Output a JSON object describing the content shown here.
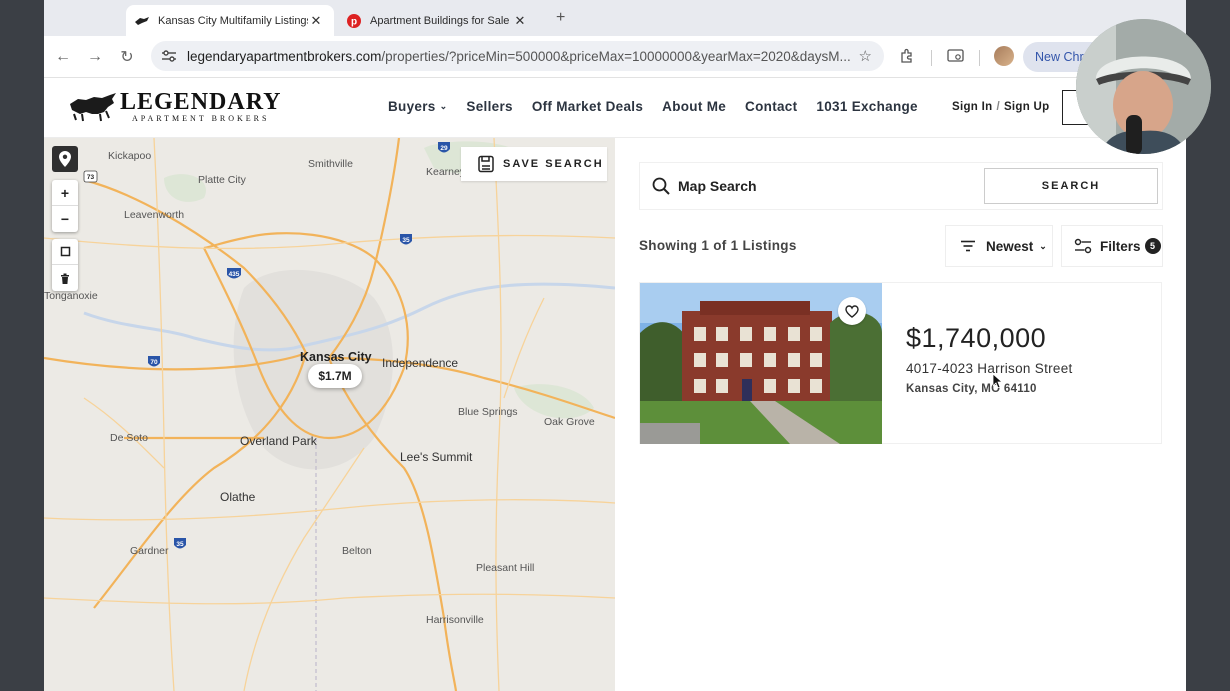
{
  "browser": {
    "tabs": [
      {
        "title": "Kansas City Multifamily Listings",
        "active": true
      },
      {
        "title": "Apartment Buildings for Sale",
        "active": false
      }
    ],
    "url_host": "legendaryapartmentbrokers.com",
    "url_path": "/properties/?priceMin=500000&priceMax=10000000&yearMax=2020&daysM...",
    "new_chrome_label": "New Chro"
  },
  "site": {
    "logo_main": "LEGENDARY",
    "logo_sub": "APARTMENT BROKERS",
    "nav": [
      "Buyers",
      "Sellers",
      "Off Market Deals",
      "About Me",
      "Contact",
      "1031 Exchange"
    ],
    "sign_in": "Sign In",
    "sign_up": "Sign Up",
    "sign_sep": "/"
  },
  "map": {
    "save_search": "SAVE SEARCH",
    "marker_price": "$1.7M",
    "labels": {
      "kansas_city": "Kansas City",
      "kickapoo": "Kickapoo",
      "platte_city": "Platte City",
      "smithville": "Smithville",
      "kearney": "Kearney",
      "leavenworth": "Leavenworth",
      "tonganoxie": "Tonganoxie",
      "independence": "Independence",
      "blue_springs": "Blue Springs",
      "oak_grove": "Oak Grove",
      "de_soto": "De Soto",
      "overland_park": "Overland Park",
      "lees_summit": "Lee's Summit",
      "olathe": "Olathe",
      "gardner": "Gardner",
      "belton": "Belton",
      "pleasant_hill": "Pleasant Hill",
      "harrisonville": "Harrisonville"
    },
    "shields": {
      "i29": "29",
      "i35n": "35",
      "i435": "435",
      "i70": "70",
      "i35s": "35",
      "us73": "73"
    }
  },
  "listings": {
    "search_label": "Map Search",
    "search_button": "SEARCH",
    "showing": "Showing 1 of 1 Listings",
    "sort_label": "Newest",
    "filters_label": "Filters",
    "filters_count": "5",
    "items": [
      {
        "price": "$1,740,000",
        "street": "4017-4023 Harrison Street",
        "city_state": "Kansas City, MO 64110"
      }
    ]
  },
  "colors": {
    "accent": "#222222",
    "map_bg": "#eceae5",
    "road_major": "#f2b35a"
  }
}
